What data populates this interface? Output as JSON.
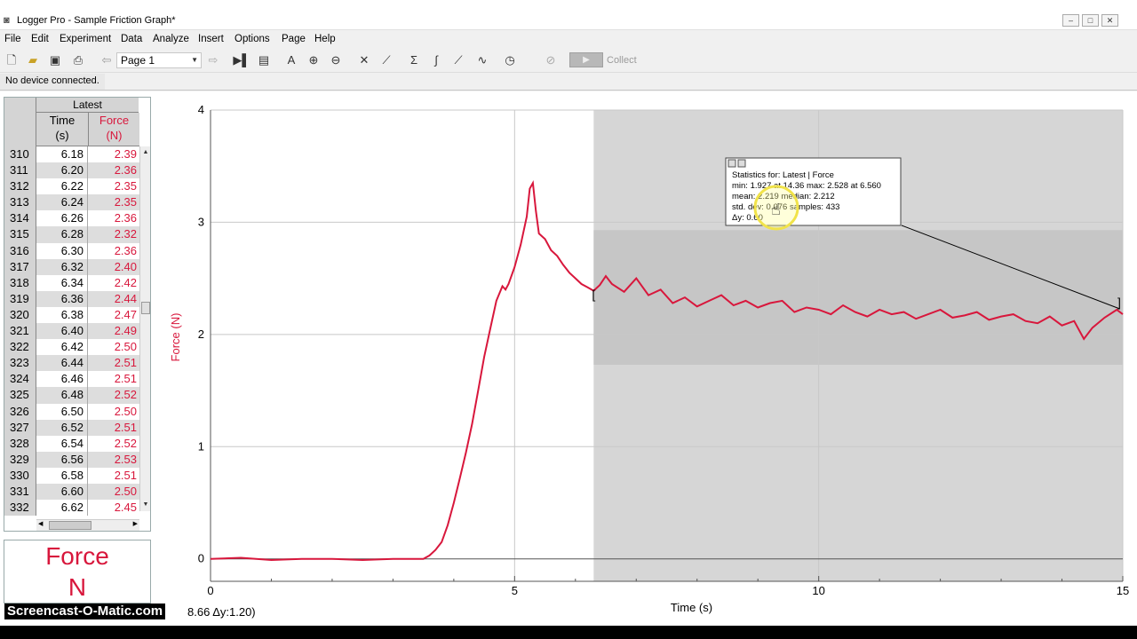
{
  "window": {
    "title": "Logger Pro - Sample Friction Graph*",
    "controls": [
      "minimize",
      "maximize",
      "close"
    ]
  },
  "menu": [
    "File",
    "Edit",
    "Experiment",
    "Data",
    "Analyze",
    "Insert",
    "Options",
    "Page",
    "Help"
  ],
  "toolbar": {
    "page_select": "Page 1",
    "collect_label": "Collect"
  },
  "status": "No device connected.",
  "table": {
    "dataset": "Latest",
    "columns": [
      {
        "line1": "Time",
        "line2": "(s)",
        "color": "#000000"
      },
      {
        "line1": "Force",
        "line2": "(N)",
        "color": "#d8173c"
      }
    ],
    "rows": [
      [
        "310",
        "6.18",
        "2.39"
      ],
      [
        "311",
        "6.20",
        "2.36"
      ],
      [
        "312",
        "6.22",
        "2.35"
      ],
      [
        "313",
        "6.24",
        "2.35"
      ],
      [
        "314",
        "6.26",
        "2.36"
      ],
      [
        "315",
        "6.28",
        "2.32"
      ],
      [
        "316",
        "6.30",
        "2.36"
      ],
      [
        "317",
        "6.32",
        "2.40"
      ],
      [
        "318",
        "6.34",
        "2.42"
      ],
      [
        "319",
        "6.36",
        "2.44"
      ],
      [
        "320",
        "6.38",
        "2.47"
      ],
      [
        "321",
        "6.40",
        "2.49"
      ],
      [
        "322",
        "6.42",
        "2.50"
      ],
      [
        "323",
        "6.44",
        "2.51"
      ],
      [
        "324",
        "6.46",
        "2.51"
      ],
      [
        "325",
        "6.48",
        "2.52"
      ],
      [
        "326",
        "6.50",
        "2.50"
      ],
      [
        "327",
        "6.52",
        "2.51"
      ],
      [
        "328",
        "6.54",
        "2.52"
      ],
      [
        "329",
        "6.56",
        "2.53"
      ],
      [
        "330",
        "6.58",
        "2.51"
      ],
      [
        "331",
        "6.60",
        "2.50"
      ],
      [
        "332",
        "6.62",
        "2.45"
      ]
    ]
  },
  "meter": {
    "label": "Force",
    "unit": "N"
  },
  "chart_data": {
    "type": "line",
    "xlabel": "Time (s)",
    "ylabel": "Force (N)",
    "xlim": [
      0,
      15
    ],
    "ylim": [
      -0.2,
      4
    ],
    "xticks": [
      "0",
      "5",
      "10",
      "15"
    ],
    "yticks": [
      "0",
      "1",
      "2",
      "3",
      "4"
    ],
    "grid": true,
    "series_color": "#d8173c",
    "selection_range": [
      6.3,
      15
    ],
    "series": [
      {
        "x": [
          0,
          0.5,
          1,
          1.5,
          2,
          2.5,
          3,
          3.5,
          3.6,
          3.7,
          3.8,
          3.9,
          4.0,
          4.1,
          4.2,
          4.3,
          4.4,
          4.5,
          4.6,
          4.7,
          4.8,
          4.85,
          4.9,
          5.0,
          5.1,
          5.2,
          5.25,
          5.3,
          5.35,
          5.4,
          5.5,
          5.6,
          5.7,
          5.8,
          5.9,
          6.0,
          6.1,
          6.2,
          6.3,
          6.4,
          6.5,
          6.6,
          6.8,
          7.0,
          7.2,
          7.4,
          7.6,
          7.8,
          8.0,
          8.2,
          8.4,
          8.6,
          8.8,
          9.0,
          9.2,
          9.4,
          9.6,
          9.8,
          10.0,
          10.2,
          10.4,
          10.6,
          10.8,
          11.0,
          11.2,
          11.4,
          11.6,
          11.8,
          12.0,
          12.2,
          12.4,
          12.6,
          12.8,
          13.0,
          13.2,
          13.4,
          13.6,
          13.8,
          14.0,
          14.2,
          14.36,
          14.5,
          14.7,
          14.9,
          15.0
        ],
        "y": [
          0.0,
          0.01,
          -0.01,
          0.0,
          0.0,
          -0.01,
          0.0,
          0.0,
          0.03,
          0.08,
          0.15,
          0.3,
          0.5,
          0.72,
          0.95,
          1.2,
          1.5,
          1.8,
          2.05,
          2.3,
          2.43,
          2.4,
          2.45,
          2.6,
          2.8,
          3.05,
          3.3,
          3.35,
          3.1,
          2.9,
          2.85,
          2.75,
          2.7,
          2.62,
          2.55,
          2.5,
          2.45,
          2.42,
          2.39,
          2.44,
          2.52,
          2.45,
          2.38,
          2.5,
          2.35,
          2.4,
          2.28,
          2.33,
          2.25,
          2.3,
          2.35,
          2.26,
          2.3,
          2.24,
          2.28,
          2.3,
          2.2,
          2.24,
          2.22,
          2.18,
          2.26,
          2.2,
          2.16,
          2.22,
          2.18,
          2.2,
          2.14,
          2.18,
          2.22,
          2.15,
          2.17,
          2.2,
          2.13,
          2.16,
          2.18,
          2.12,
          2.1,
          2.16,
          2.08,
          2.12,
          1.96,
          2.06,
          2.15,
          2.22,
          2.18
        ]
      }
    ]
  },
  "stats_box": {
    "line1": "Statistics for: Latest | Force",
    "line2": "min: 1.927 at 14.36  max: 2.528 at 6.560",
    "line3": "mean: 2.219  median: 2.212",
    "line4": "std. dev: 0.076  samples: 433",
    "line5": "Δy: 0.60"
  },
  "coordinate_readout": "8.66 Δy:1.20)",
  "watermark": "Screencast-O-Matic.com"
}
